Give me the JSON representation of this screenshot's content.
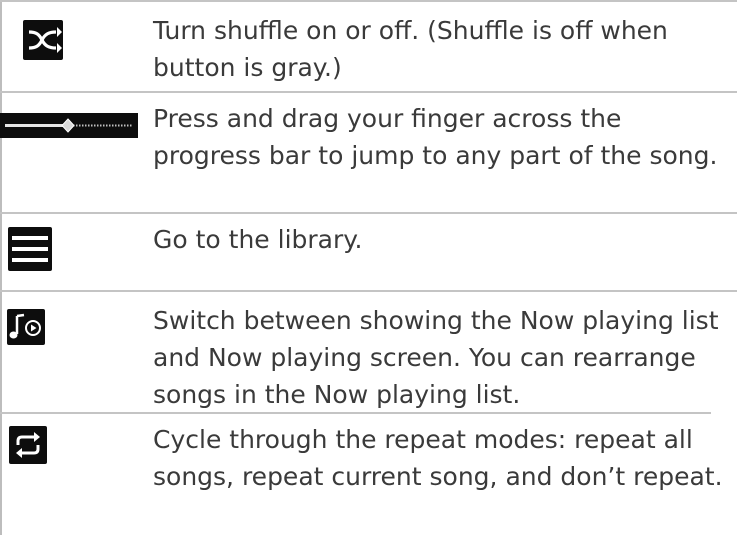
{
  "rows": [
    {
      "icon": "shuffle-icon",
      "text": "Turn shuffle on or off. (Shuffle is off when button is gray.)"
    },
    {
      "icon": "progress-bar-icon",
      "text": "Press and drag your finger across the progress bar to jump to any part of the song."
    },
    {
      "icon": "library-menu-icon",
      "text": "Go to the library."
    },
    {
      "icon": "now-playing-icon",
      "text": "Switch between showing the Now playing list and Now playing screen. You can rearrange songs in the Now playing list."
    },
    {
      "icon": "repeat-icon",
      "text": "Cycle through the repeat modes: repeat all songs, repeat current song, and don’t repeat."
    }
  ],
  "colors": {
    "text": "#3a3a3a",
    "rule": "#c4c4c4",
    "icon_bg": "#0d0d0d",
    "icon_fg": "#ffffff"
  }
}
